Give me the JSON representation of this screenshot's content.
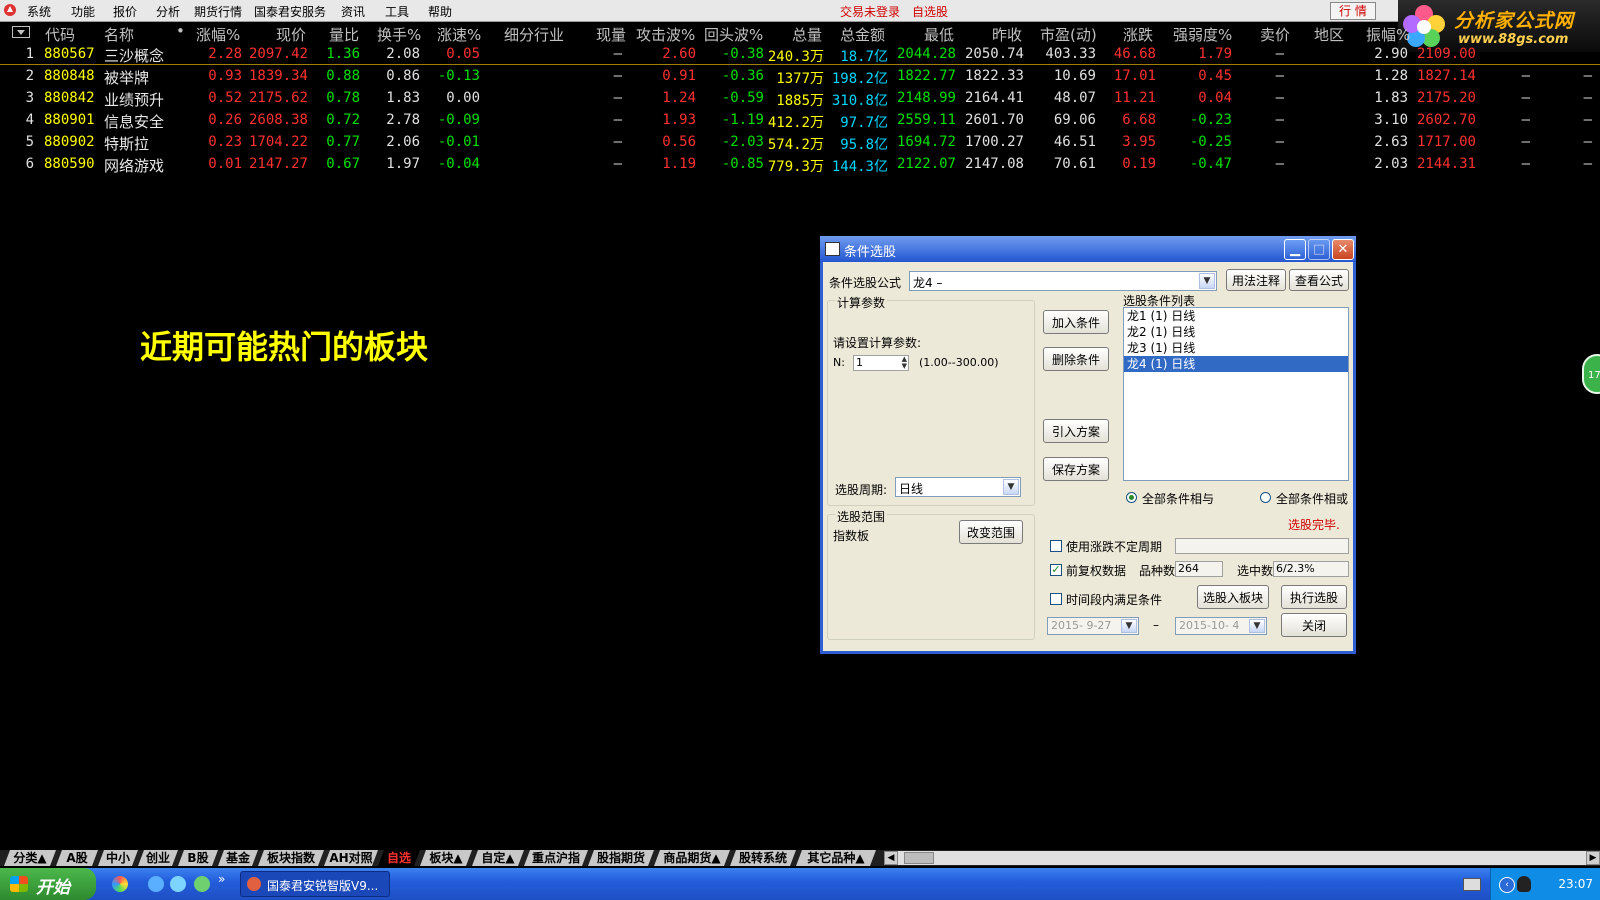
{
  "menu": {
    "items": [
      "系统",
      "功能",
      "报价",
      "分析",
      "期货行情",
      "国泰君安服务",
      "资讯",
      "工具",
      "帮助"
    ],
    "status_trade": "交易未登录",
    "status_watch": "自选股",
    "btn_quote": "行 情"
  },
  "logo": {
    "title": "分析家公式网",
    "url": "www.88gs.com"
  },
  "table": {
    "headers": [
      "代码",
      "名称",
      "涨幅%",
      "现价",
      "量比",
      "换手%",
      "涨速%",
      "细分行业",
      "现量",
      "攻击波%",
      "回头波%",
      "总量",
      "总金额",
      "最低",
      "昨收",
      "市盈(动)",
      "涨跌",
      "强弱度%",
      "卖价",
      "地区",
      "振幅%"
    ],
    "rows": [
      {
        "idx": "1",
        "code": "880567",
        "name": "三沙概念",
        "chg": "2.28",
        "price": "2097.42",
        "vr": "1.36",
        "turn": "2.08",
        "speed": "0.05",
        "cur": "–",
        "atk": "2.60",
        "back": "-0.38",
        "vol": "240.3万",
        "amt": "18.7亿",
        "low": "2044.28",
        "prev": "2050.74",
        "pe": "403.33",
        "diff": "46.68",
        "rs": "1.79",
        "ask": "–",
        "amp": "2.90",
        "extra": "2109.00",
        "extra2": "",
        "extra3": ""
      },
      {
        "idx": "2",
        "code": "880848",
        "name": "被举牌",
        "chg": "0.93",
        "price": "1839.34",
        "vr": "0.88",
        "turn": "0.86",
        "speed": "-0.13",
        "cur": "–",
        "atk": "0.91",
        "back": "-0.36",
        "vol": "1377万",
        "amt": "198.2亿",
        "low": "1822.77",
        "prev": "1822.33",
        "pe": "10.69",
        "diff": "17.01",
        "rs": "0.45",
        "ask": "–",
        "amp": "1.28",
        "extra": "1827.14",
        "extra2": "–",
        "extra3": "–"
      },
      {
        "idx": "3",
        "code": "880842",
        "name": "业绩预升",
        "chg": "0.52",
        "price": "2175.62",
        "vr": "0.78",
        "turn": "1.83",
        "speed": "0.00",
        "cur": "–",
        "atk": "1.24",
        "back": "-0.59",
        "vol": "1885万",
        "amt": "310.8亿",
        "low": "2148.99",
        "prev": "2164.41",
        "pe": "48.07",
        "diff": "11.21",
        "rs": "0.04",
        "ask": "–",
        "amp": "1.83",
        "extra": "2175.20",
        "extra2": "–",
        "extra3": "–"
      },
      {
        "idx": "4",
        "code": "880901",
        "name": "信息安全",
        "chg": "0.26",
        "price": "2608.38",
        "vr": "0.72",
        "turn": "2.78",
        "speed": "-0.09",
        "cur": "–",
        "atk": "1.93",
        "back": "-1.19",
        "vol": "412.2万",
        "amt": "97.7亿",
        "low": "2559.11",
        "prev": "2601.70",
        "pe": "69.06",
        "diff": "6.68",
        "rs": "-0.23",
        "ask": "–",
        "amp": "3.10",
        "extra": "2602.70",
        "extra2": "–",
        "extra3": "–"
      },
      {
        "idx": "5",
        "code": "880902",
        "name": "特斯拉",
        "chg": "0.23",
        "price": "1704.22",
        "vr": "0.77",
        "turn": "2.06",
        "speed": "-0.01",
        "cur": "–",
        "atk": "0.56",
        "back": "-2.03",
        "vol": "574.2万",
        "amt": "95.8亿",
        "low": "1694.72",
        "prev": "1700.27",
        "pe": "46.51",
        "diff": "3.95",
        "rs": "-0.25",
        "ask": "–",
        "amp": "2.63",
        "extra": "1717.00",
        "extra2": "–",
        "extra3": "–"
      },
      {
        "idx": "6",
        "code": "880590",
        "name": "网络游戏",
        "chg": "0.01",
        "price": "2147.27",
        "vr": "0.67",
        "turn": "1.97",
        "speed": "-0.04",
        "cur": "–",
        "atk": "1.19",
        "back": "-0.85",
        "vol": "779.3万",
        "amt": "144.3亿",
        "low": "2122.07",
        "prev": "2147.08",
        "pe": "70.61",
        "diff": "0.19",
        "rs": "-0.47",
        "ask": "–",
        "amp": "2.03",
        "extra": "2144.31",
        "extra2": "–",
        "extra3": "–"
      }
    ]
  },
  "headline": "近期可能热门的板块",
  "dialog": {
    "title": "条件选股",
    "formula_label": "条件选股公式",
    "formula_value": "龙4     –",
    "btn_usage": "用法注释",
    "btn_view": "查看公式",
    "calc_group": "计算参数",
    "param_prompt": "请设置计算参数:",
    "param_n_label": "N:",
    "param_n_value": "1",
    "param_range": "(1.00--300.00)",
    "period_label": "选股周期:",
    "period_value": "日线",
    "btn_add": "加入条件",
    "btn_del": "删除条件",
    "btn_import": "引入方案",
    "btn_save": "保存方案",
    "list_label": "选股条件列表",
    "conditions": [
      "龙1 (1) 日线",
      "龙2 (1) 日线",
      "龙3 (1) 日线",
      "龙4 (1) 日线"
    ],
    "selected_index": 3,
    "radio_and": "全部条件相与",
    "radio_or": "全部条件相或",
    "done_text": "选股完毕.",
    "scope_group": "选股范围",
    "scope_value": "指数板",
    "btn_scope": "改变范围",
    "chk_variable_period": "使用涨跌不定周期",
    "chk_forward_adj": "前复权数据",
    "count_label": "品种数",
    "count_value": "264",
    "selected_label": "选中数",
    "selected_value": "6/2.3%",
    "chk_time_range": "时间段内满足条件",
    "btn_to_block": "选股入板块",
    "btn_execute": "执行选股",
    "date_from": "2015- 9-27",
    "date_sep": "–",
    "date_to": "2015-10- 4",
    "btn_close": "关闭"
  },
  "sidebadge": "17",
  "tabs": [
    "分类▲",
    "A股",
    "中小",
    "创业",
    "B股",
    "基金",
    "板块指数",
    "AH对照",
    "自选",
    "板块▲",
    "自定▲",
    "重点沪指",
    "股指期货",
    "商品期货▲",
    "股转系统",
    "其它品种▲"
  ],
  "active_tab": "自选",
  "taskbar": {
    "start": "开始",
    "window": "国泰君安锐智版V9...",
    "clock": "23:07"
  }
}
